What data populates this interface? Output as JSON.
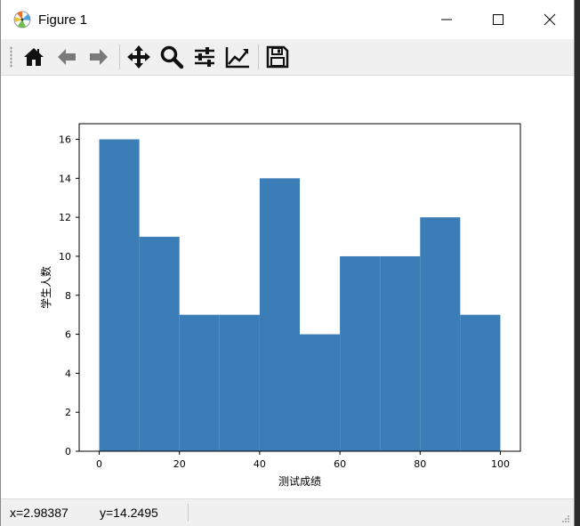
{
  "window": {
    "title": "Figure 1"
  },
  "toolbar": {
    "buttons": [
      {
        "name": "home-button",
        "icon": "home-icon",
        "label": "Home"
      },
      {
        "name": "back-button",
        "icon": "arrow-left-icon",
        "label": "Back"
      },
      {
        "name": "forward-button",
        "icon": "arrow-right-icon",
        "label": "Forward"
      },
      {
        "name": "pan-button",
        "icon": "move-icon",
        "label": "Pan"
      },
      {
        "name": "zoom-button",
        "icon": "magnifier-icon",
        "label": "Zoom"
      },
      {
        "name": "subplots-button",
        "icon": "sliders-icon",
        "label": "Subplots"
      },
      {
        "name": "edit-axes-button",
        "icon": "line-chart-icon",
        "label": "Customize"
      },
      {
        "name": "save-button",
        "icon": "floppy-icon",
        "label": "Save"
      }
    ]
  },
  "status": {
    "x_readout": "x=2.98387",
    "y_readout": "y=14.2495"
  },
  "chart_data": {
    "type": "bar",
    "bin_edges": [
      0,
      10,
      20,
      30,
      40,
      50,
      60,
      70,
      80,
      90,
      100
    ],
    "values": [
      16,
      11,
      7,
      7,
      14,
      6,
      10,
      10,
      12,
      7
    ],
    "xlabel": "测试成绩",
    "ylabel": "学生人数",
    "xlim": [
      -5,
      105
    ],
    "ylim": [
      0,
      16.8
    ],
    "xticks": [
      0,
      20,
      40,
      60,
      80,
      100
    ],
    "yticks": [
      0,
      2,
      4,
      6,
      8,
      10,
      12,
      14,
      16
    ],
    "bar_color": "#3a7db7",
    "grid": false
  }
}
